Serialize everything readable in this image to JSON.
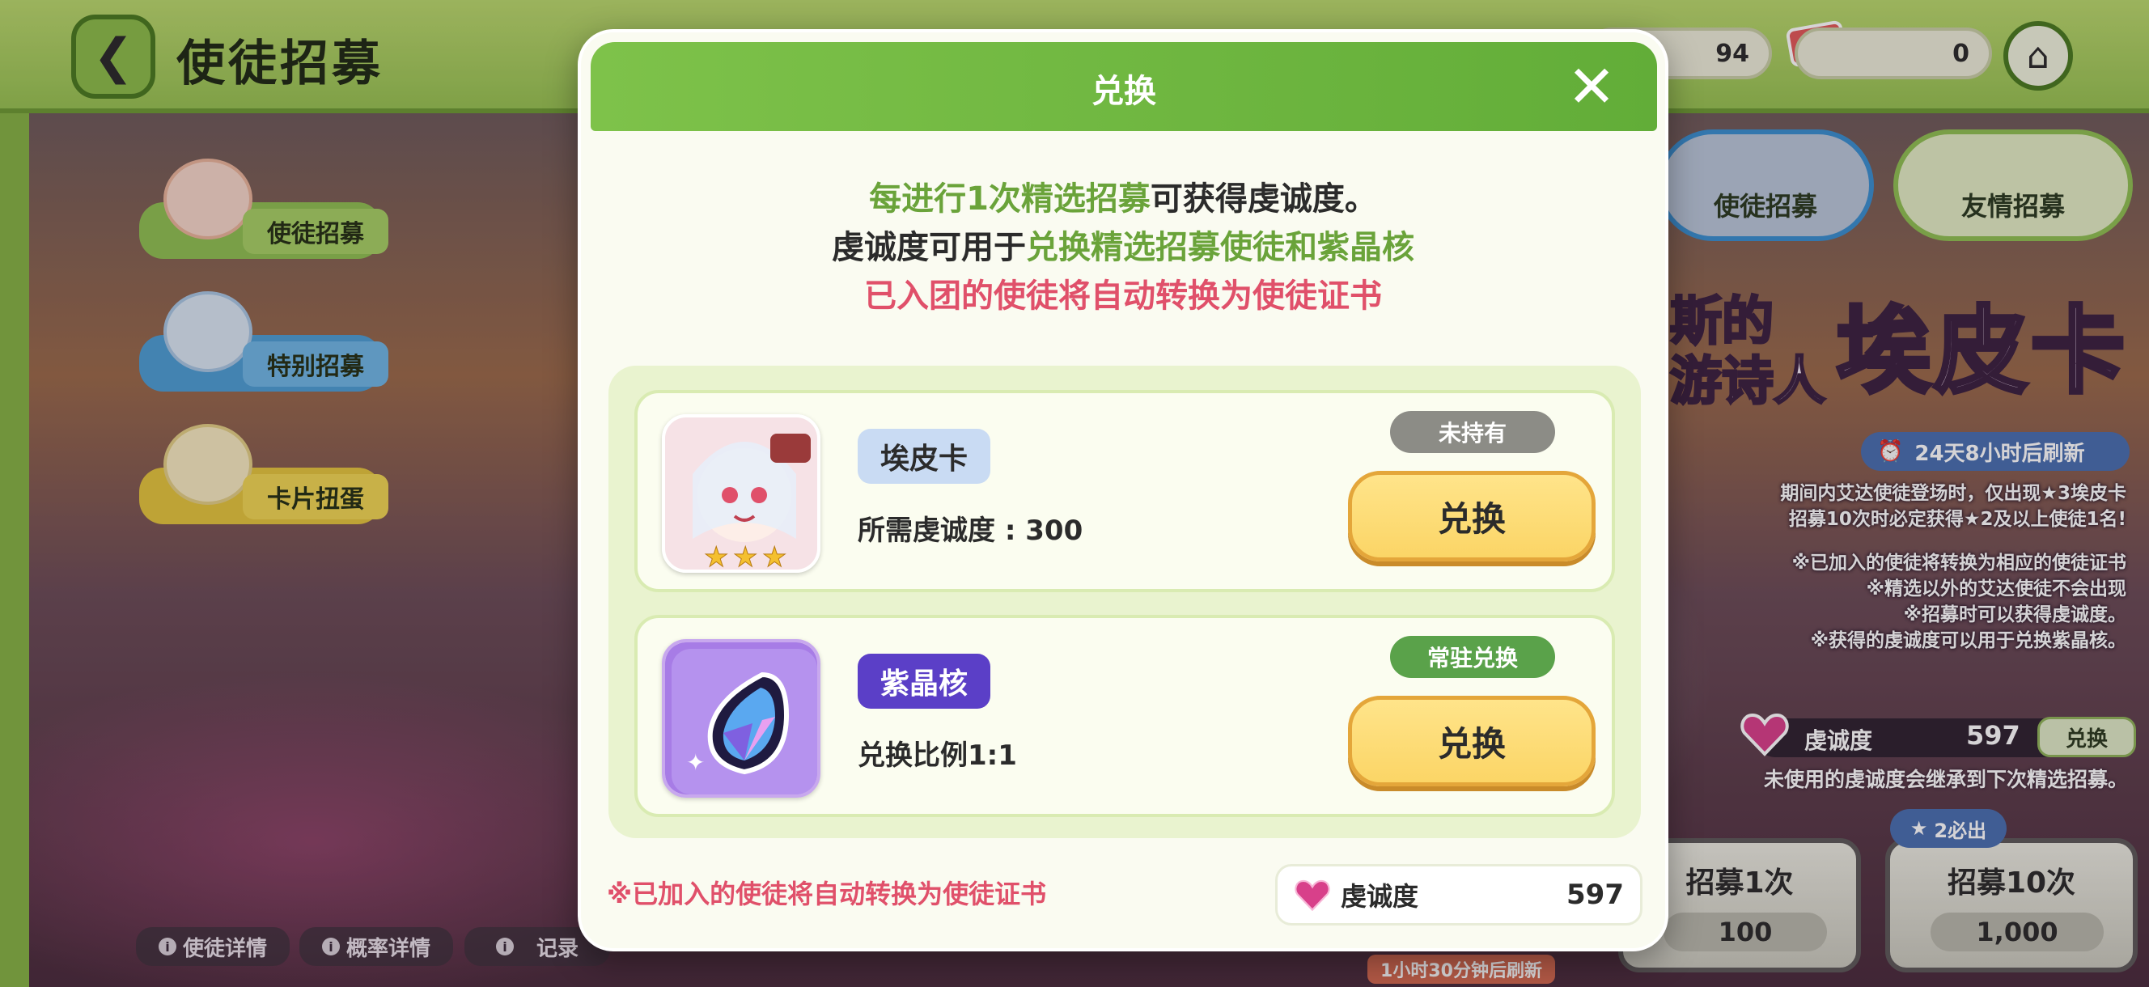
{
  "header": {
    "title": "使徒招募",
    "resource_value_1": "94",
    "resource_value_2": "0"
  },
  "sidebar": {
    "items": [
      {
        "label": "使徒招募"
      },
      {
        "label": "特别招募"
      },
      {
        "label": "卡片扭蛋"
      }
    ]
  },
  "tabs": [
    {
      "label": "使徒招募"
    },
    {
      "label": "友情招募"
    }
  ],
  "banner": {
    "title_partial": "斯的",
    "subtitle_partial": "游诗人",
    "name": "埃皮卡",
    "timer": "24天8小时后刷新",
    "info_line_1": "期间内艾达使徒登场时，仅出现★3埃皮卡",
    "info_line_2": "招募10次时必定获得★2及以上使徒1名!",
    "notes": [
      "※已加入的使徒将转换为相应的使徒证书",
      "※精选以外的艾达使徒不会出现",
      "※招募时可以获得虔诚度。",
      "※获得的虔诚度可以用于兑换紫晶核。"
    ],
    "devotion_label": "虔诚度",
    "devotion_value": "597",
    "devotion_exchange": "兑换",
    "carry_note": "未使用的虔诚度会继承到下次精选招募。"
  },
  "recruit": {
    "guarantee": "2必出",
    "single": {
      "label": "招募1次",
      "cost": "100"
    },
    "ten": {
      "label": "招募10次",
      "cost": "1,000"
    },
    "refresh": "1小时30分钟后刷新"
  },
  "bottom_bar": {
    "details": "使徒详情",
    "probability": "概率详情",
    "records": "记录"
  },
  "modal": {
    "title": "兑换",
    "intro_line1_green": "每进行1次精选招募",
    "intro_line1_dark": "可获得虔诚度。",
    "intro_line2_dark": "虔诚度可用于",
    "intro_line2_green": "兑换精选招募使徒和紫晶核",
    "intro_line3_pink": "已入团的使徒将自动转换为使徒证书",
    "items": [
      {
        "name": "埃皮卡",
        "detail": "所需虔诚度 : 300",
        "status": "未持有",
        "button": "兑换"
      },
      {
        "name": "紫晶核",
        "detail": "兑换比例1:1",
        "status": "常驻兑换",
        "button": "兑换"
      }
    ],
    "footer_note": "※已加入的使徒将自动转换为使徒证书",
    "footer_devotion_label": "虔诚度",
    "footer_devotion_value": "597"
  },
  "colors": {
    "accent_green": "#6aa33a",
    "warning_pink": "#e0506a",
    "button_yellow": "#fbd566",
    "status_grey": "#8c8c86",
    "status_green": "#5aa24a",
    "tag_blue": "#c9dbf3",
    "tag_purple": "#5b3fc7"
  },
  "icons": {
    "back": "chevron-left-icon",
    "home": "home-icon",
    "close": "close-icon",
    "heart": "heart-gem-icon",
    "clock": "alarm-icon",
    "info": "info-icon"
  }
}
